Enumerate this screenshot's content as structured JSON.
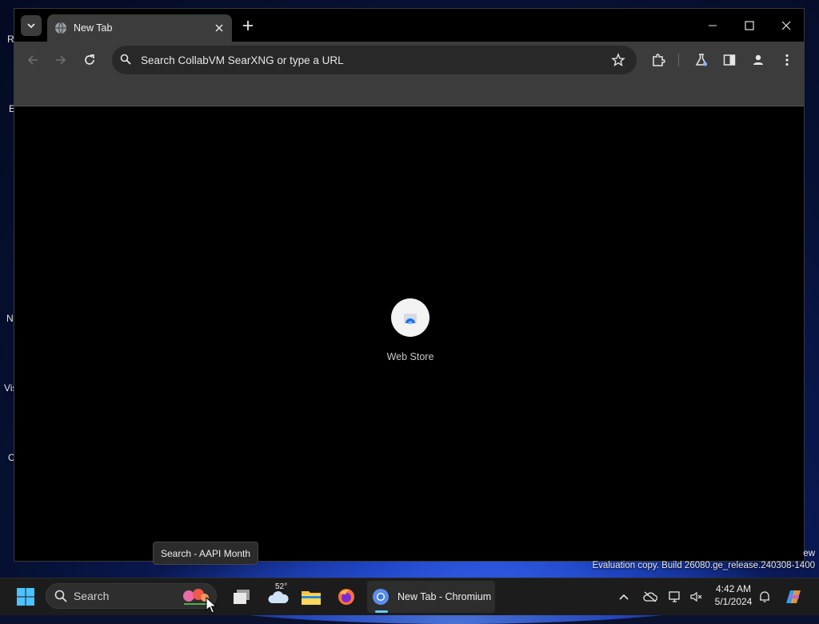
{
  "desktop": {
    "labels": [
      "Re",
      "E",
      "N",
      "Vis",
      "C"
    ],
    "evaluation_suffix": "ew",
    "evaluation_text": "Evaluation copy. Build 26080.ge_release.240308-1400"
  },
  "browser": {
    "tab": {
      "title": "New Tab"
    },
    "omnibox": {
      "placeholder": "Search CollabVM SearXNG or type a URL"
    },
    "shortcuts": [
      {
        "label": "Web Store"
      }
    ]
  },
  "tooltip": {
    "text": "Search - AAPI Month"
  },
  "taskbar": {
    "search_label": "Search",
    "weather_temp": "52°",
    "chromium_label": "New Tab - Chromium",
    "clock": {
      "time": "4:42 AM",
      "date": "5/1/2024"
    },
    "accent_color": "#60cdff"
  }
}
